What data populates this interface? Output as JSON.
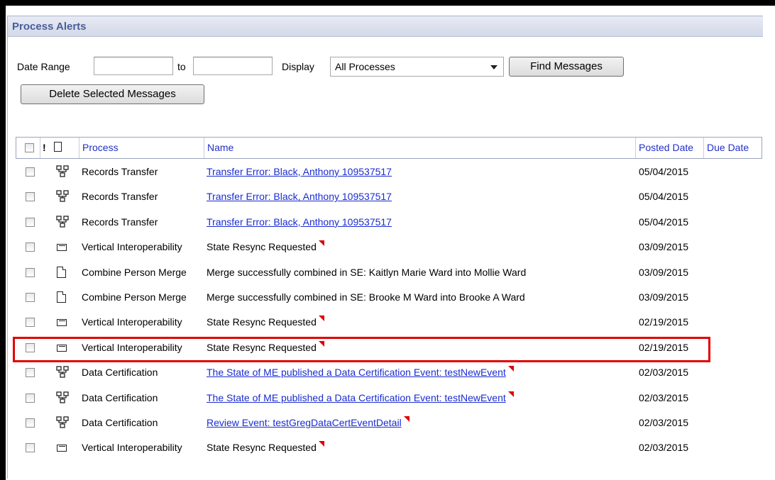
{
  "panel": {
    "title": "Process Alerts"
  },
  "filters": {
    "date_range_label": "Date Range",
    "to_label": "to",
    "date_from": "",
    "date_to": "",
    "display_label": "Display",
    "display_value": "All Processes",
    "find_button": "Find Messages",
    "delete_button": "Delete Selected Messages"
  },
  "table": {
    "columns": {
      "priority": "!",
      "process": "Process",
      "name": "Name",
      "posted_date": "Posted Date",
      "due_date": "Due Date"
    },
    "rows": [
      {
        "icon": "process-flow-icon",
        "process": "Records Transfer",
        "name": "Transfer Error: Black, Anthony 109537517",
        "link": true,
        "flag": false,
        "posted": "05/04/2015",
        "due": ""
      },
      {
        "icon": "process-flow-icon",
        "process": "Records Transfer",
        "name": "Transfer Error: Black, Anthony 109537517",
        "link": true,
        "flag": false,
        "posted": "05/04/2015",
        "due": ""
      },
      {
        "icon": "process-flow-icon",
        "process": "Records Transfer",
        "name": "Transfer Error: Black, Anthony 109537517",
        "link": true,
        "flag": false,
        "posted": "05/04/2015",
        "due": ""
      },
      {
        "icon": "envelope-icon",
        "process": "Vertical Interoperability",
        "name": "State Resync Requested",
        "link": false,
        "flag": true,
        "posted": "03/09/2015",
        "due": ""
      },
      {
        "icon": "document-icon",
        "process": "Combine Person Merge",
        "name": "Merge successfully combined in SE: Kaitlyn Marie Ward into Mollie Ward",
        "link": false,
        "flag": false,
        "posted": "03/09/2015",
        "due": ""
      },
      {
        "icon": "document-icon",
        "process": "Combine Person Merge",
        "name": "Merge successfully combined in SE: Brooke M Ward into Brooke A Ward",
        "link": false,
        "flag": false,
        "posted": "03/09/2015",
        "due": ""
      },
      {
        "icon": "envelope-icon",
        "process": "Vertical Interoperability",
        "name": "State Resync Requested",
        "link": false,
        "flag": true,
        "posted": "02/19/2015",
        "due": ""
      },
      {
        "icon": "envelope-icon",
        "process": "Vertical Interoperability",
        "name": "State Resync Requested",
        "link": false,
        "flag": true,
        "posted": "02/19/2015",
        "due": ""
      },
      {
        "icon": "process-flow-icon",
        "process": "Data Certification",
        "name": "The State of ME published a Data Certification Event: testNewEvent",
        "link": true,
        "flag": true,
        "posted": "02/03/2015",
        "due": ""
      },
      {
        "icon": "process-flow-icon",
        "process": "Data Certification",
        "name": "The State of ME published a Data Certification Event: testNewEvent",
        "link": true,
        "flag": true,
        "posted": "02/03/2015",
        "due": ""
      },
      {
        "icon": "process-flow-icon",
        "process": "Data Certification",
        "name": "Review Event: testGregDataCertEventDetail",
        "link": true,
        "flag": true,
        "posted": "02/03/2015",
        "due": ""
      },
      {
        "icon": "envelope-icon",
        "process": "Vertical Interoperability",
        "name": "State Resync Requested",
        "link": false,
        "flag": true,
        "posted": "02/03/2015",
        "due": ""
      }
    ],
    "highlight_color": "#e20000"
  }
}
